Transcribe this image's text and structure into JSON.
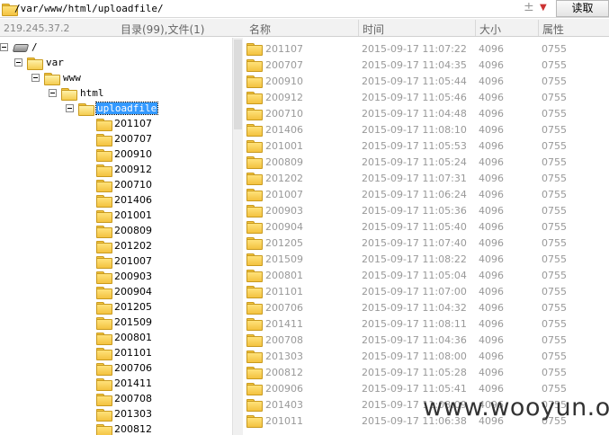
{
  "address": {
    "path": "/var/www/html/uploadfile/",
    "read_button": "读取"
  },
  "info": {
    "ip": "219.245.37.2",
    "dir_count": "目录(99),文件(1)"
  },
  "columns": {
    "name": "名称",
    "time": "时间",
    "size": "大小",
    "attr": "属性"
  },
  "tree": {
    "root": "/",
    "var": "var",
    "www": "www",
    "html": "html",
    "uploadfile": "uploadfile",
    "children": [
      "201107",
      "200707",
      "200910",
      "200912",
      "200710",
      "201406",
      "201001",
      "200809",
      "201202",
      "201007",
      "200903",
      "200904",
      "201205",
      "201509",
      "200801",
      "201101",
      "200706",
      "201411",
      "200708",
      "201303",
      "200812"
    ]
  },
  "files": [
    {
      "name": "201107",
      "time": "2015-09-17 11:07:22",
      "size": "4096",
      "attr": "0755"
    },
    {
      "name": "200707",
      "time": "2015-09-17 11:04:35",
      "size": "4096",
      "attr": "0755"
    },
    {
      "name": "200910",
      "time": "2015-09-17 11:05:44",
      "size": "4096",
      "attr": "0755"
    },
    {
      "name": "200912",
      "time": "2015-09-17 11:05:46",
      "size": "4096",
      "attr": "0755"
    },
    {
      "name": "200710",
      "time": "2015-09-17 11:04:48",
      "size": "4096",
      "attr": "0755"
    },
    {
      "name": "201406",
      "time": "2015-09-17 11:08:10",
      "size": "4096",
      "attr": "0755"
    },
    {
      "name": "201001",
      "time": "2015-09-17 11:05:53",
      "size": "4096",
      "attr": "0755"
    },
    {
      "name": "200809",
      "time": "2015-09-17 11:05:24",
      "size": "4096",
      "attr": "0755"
    },
    {
      "name": "201202",
      "time": "2015-09-17 11:07:31",
      "size": "4096",
      "attr": "0755"
    },
    {
      "name": "201007",
      "time": "2015-09-17 11:06:24",
      "size": "4096",
      "attr": "0755"
    },
    {
      "name": "200903",
      "time": "2015-09-17 11:05:36",
      "size": "4096",
      "attr": "0755"
    },
    {
      "name": "200904",
      "time": "2015-09-17 11:05:40",
      "size": "4096",
      "attr": "0755"
    },
    {
      "name": "201205",
      "time": "2015-09-17 11:07:40",
      "size": "4096",
      "attr": "0755"
    },
    {
      "name": "201509",
      "time": "2015-09-17 11:08:22",
      "size": "4096",
      "attr": "0755"
    },
    {
      "name": "200801",
      "time": "2015-09-17 11:05:04",
      "size": "4096",
      "attr": "0755"
    },
    {
      "name": "201101",
      "time": "2015-09-17 11:07:00",
      "size": "4096",
      "attr": "0755"
    },
    {
      "name": "200706",
      "time": "2015-09-17 11:04:32",
      "size": "4096",
      "attr": "0755"
    },
    {
      "name": "201411",
      "time": "2015-09-17 11:08:11",
      "size": "4096",
      "attr": "0755"
    },
    {
      "name": "200708",
      "time": "2015-09-17 11:04:36",
      "size": "4096",
      "attr": "0755"
    },
    {
      "name": "201303",
      "time": "2015-09-17 11:08:00",
      "size": "4096",
      "attr": "0755"
    },
    {
      "name": "200812",
      "time": "2015-09-17 11:05:28",
      "size": "4096",
      "attr": "0755"
    },
    {
      "name": "200906",
      "time": "2015-09-17 11:05:41",
      "size": "4096",
      "attr": "0755"
    },
    {
      "name": "201403",
      "time": "2015-09-17 11:08:09",
      "size": "4096",
      "attr": "0755"
    },
    {
      "name": "201011",
      "time": "2015-09-17 11:06:38",
      "size": "4096",
      "attr": "0755"
    }
  ],
  "watermark": "www.wooyun.org"
}
